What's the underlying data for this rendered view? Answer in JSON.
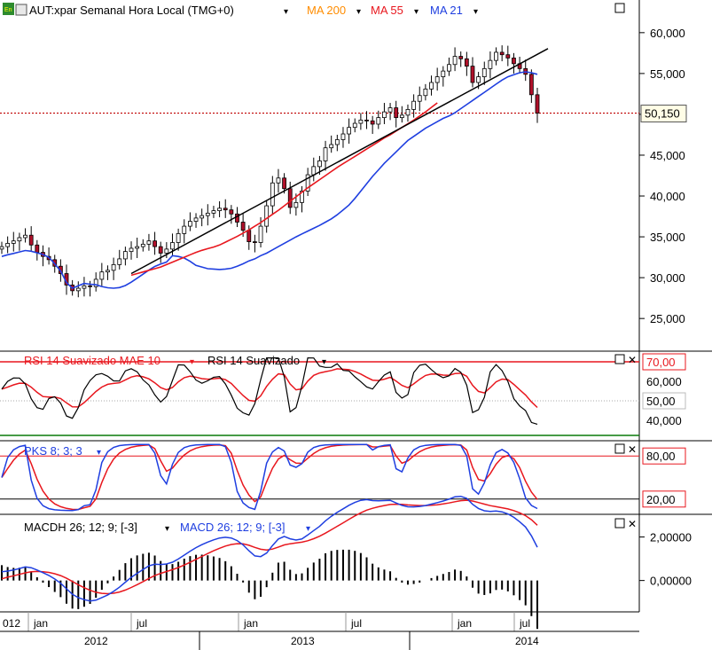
{
  "header": {
    "instrument": "AUT:xpar Semanal Hora Local (TMG+0)",
    "ma200_label": "MA 200",
    "ma55_label": "MA 55",
    "ma21_label": "MA 21"
  },
  "colors": {
    "ma200": "#ff8c00",
    "ma55": "#e8171e",
    "ma21": "#1f3fe0",
    "rsi": "#000000",
    "rsi_mae": "#e8171e",
    "pks_k": "#1f3fe0",
    "pks_d": "#e8171e",
    "macd": "#1f3fe0",
    "macd_signal": "#e8171e",
    "price_line": "#c00000",
    "trend": "#000000",
    "up": "#ffffff",
    "down": "#b0102a"
  },
  "time_axis": {
    "month_labels": [
      "012",
      "jan",
      "jul",
      "jan",
      "jul",
      "jan",
      "jul"
    ],
    "year_labels": [
      "2012",
      "2013",
      "2014"
    ]
  },
  "chart_data": [
    {
      "type": "candlestick",
      "panel": "price",
      "title": "AUT:xpar Semanal Hora Local (TMG+0)",
      "ylim": [
        21000,
        64000
      ],
      "y_ticks": [
        "60,000",
        "55,000",
        "50,000",
        "45,000",
        "40,000",
        "35,000",
        "30,000",
        "25,000"
      ],
      "y_tick_values": [
        60000,
        55000,
        50000,
        45000,
        40000,
        35000,
        30000,
        25000
      ],
      "last_price_label": "50,150",
      "last_price": 50150,
      "close": [
        33800,
        34200,
        34500,
        34900,
        35200,
        34000,
        33100,
        32600,
        32200,
        31400,
        30500,
        29100,
        28400,
        28700,
        29000,
        28900,
        29800,
        30700,
        30900,
        31600,
        32300,
        33200,
        33600,
        33800,
        34100,
        34500,
        33800,
        33000,
        33500,
        34300,
        35400,
        36300,
        36900,
        37300,
        37600,
        37900,
        38200,
        38500,
        38300,
        37800,
        36800,
        35800,
        34400,
        34300,
        36300,
        38800,
        41600,
        42200,
        40900,
        38600,
        39200,
        40600,
        42600,
        43600,
        44300,
        45900,
        46300,
        46900,
        47600,
        48400,
        48900,
        49300,
        49200,
        48800,
        49600,
        50300,
        50800,
        49600,
        49900,
        50600,
        51600,
        52300,
        53100,
        53900,
        54600,
        55300,
        56100,
        57100,
        56800,
        55900,
        53900,
        54600,
        55600,
        56600,
        57600,
        57300,
        56900,
        56200,
        55600,
        54900,
        52400,
        50150
      ],
      "ma21": [
        32700,
        32600,
        32400,
        32000,
        31500,
        31300,
        31100,
        31050,
        31000,
        31050,
        31150,
        31400,
        31700,
        32050,
        32300,
        32700,
        33000,
        33400,
        33800,
        34200,
        34600,
        35000,
        35350,
        35700,
        36050,
        36400,
        36800,
        37200,
        37700,
        38300,
        38900,
        39700,
        40600,
        41500,
        42400,
        43200,
        44000,
        44700,
        45400,
        46100,
        46800,
        47300,
        47800,
        48300,
        48700,
        49100,
        49500,
        49800,
        50200,
        50700,
        51200,
        51700,
        52200,
        52700,
        53200,
        53700,
        54200,
        54600,
        54850,
        55100,
        55200,
        55100,
        54900
      ],
      "ma21_start_index": 29,
      "ma55": [
        30300,
        30500,
        30700,
        30900,
        31100,
        31300,
        31600,
        31900,
        32200,
        32500,
        32800,
        33100,
        33350,
        33550,
        33750,
        34000,
        34350,
        34700,
        35050,
        35450,
        35850,
        36300,
        36750,
        37250,
        37750,
        38250,
        38800,
        39350,
        39900,
        40450,
        41000,
        41500,
        42000,
        42500,
        43000,
        43500,
        43950,
        44400,
        44850,
        45300,
        45750,
        46200,
        46650,
        47100,
        47500,
        47950,
        48400,
        48850,
        49300,
        49800,
        50300,
        50850,
        51400
      ],
      "ma55_start_index": 39,
      "trendline": [
        [
          22,
          30500
        ],
        [
          91,
          57400
        ]
      ]
    },
    {
      "type": "line",
      "panel": "rsi",
      "series": [
        {
          "name": "RSI 14 Suavizado MAE 10"
        },
        {
          "name": "RSI 14 Suavizado"
        }
      ],
      "y_ticks": [
        "70,00",
        "60,000",
        "50,00",
        "40,000"
      ],
      "y_tick_values": [
        70,
        60,
        50,
        40
      ],
      "ylim": [
        30,
        75
      ]
    },
    {
      "type": "line",
      "panel": "pks",
      "series": [
        {
          "name": "PKS 8; 3; 3"
        }
      ],
      "y_ticks": [
        "80,00",
        "20,00"
      ],
      "y_tick_values": [
        80,
        20
      ],
      "ylim": [
        0,
        100
      ]
    },
    {
      "type": "line",
      "panel": "macd",
      "series": [
        {
          "name": "MACDH 26; 12; 9; [-3]"
        },
        {
          "name": "MACD 26; 12; 9; [-3]"
        }
      ],
      "y_ticks": [
        "2,00000",
        "0,00000"
      ],
      "y_tick_values": [
        2,
        0
      ],
      "ylim": [
        -1.4,
        3.0
      ]
    }
  ]
}
